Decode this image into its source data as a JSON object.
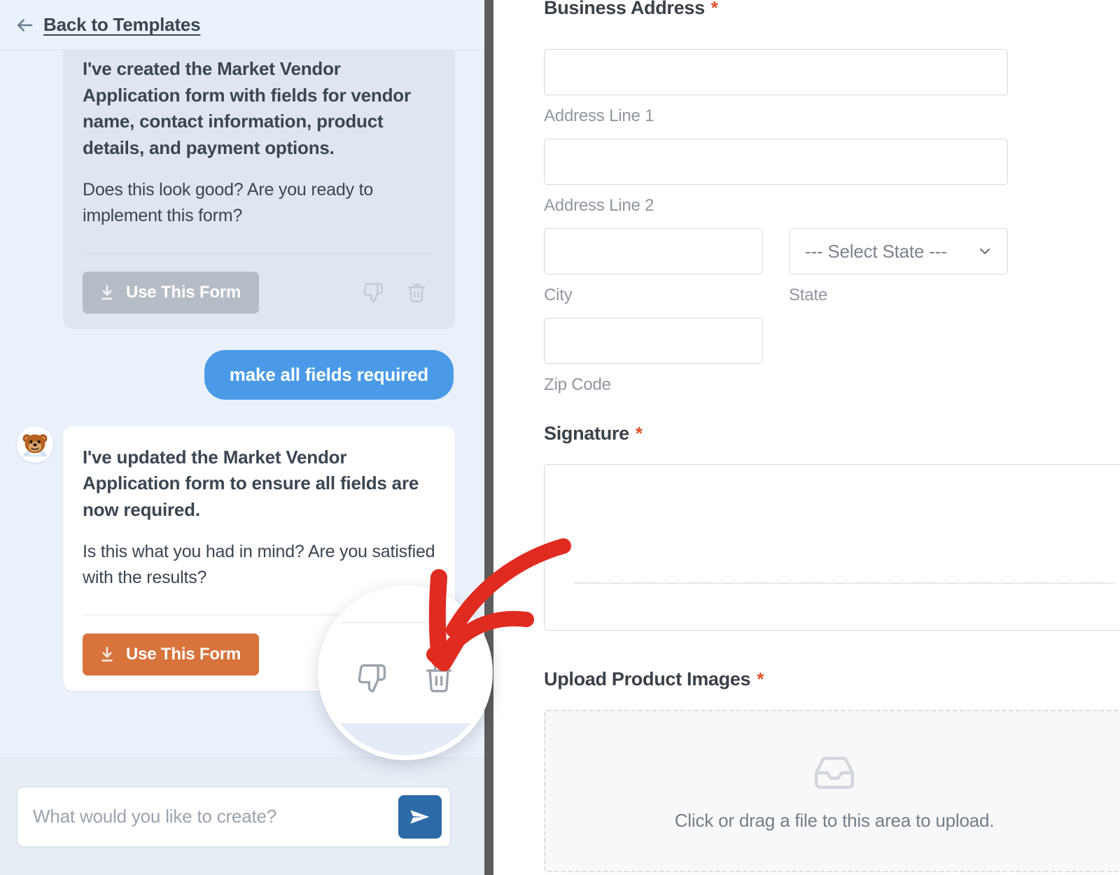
{
  "chat": {
    "header": {
      "back_label": "Back to Templates",
      "back_icon": "arrow-left-icon"
    },
    "messages": [
      {
        "role": "assistant",
        "state": "faded",
        "lead": "I've created the Market Vendor Application form with fields for vendor name, contact information, product details, and payment options.",
        "body": "Does this look good? Are you ready to implement this form?",
        "primary_button": "Use This Form",
        "actions": [
          "thumbs-down-icon",
          "trash-icon"
        ]
      },
      {
        "role": "user",
        "text": "make all fields required"
      },
      {
        "role": "assistant",
        "state": "active",
        "lead": "I've updated the Market Vendor Application form to ensure all fields are now required.",
        "body": "Is this what you had in mind? Are you satisfied with the results?",
        "primary_button": "Use This Form",
        "actions": [
          "thumbs-down-icon",
          "trash-icon"
        ]
      }
    ],
    "composer": {
      "placeholder": "What would you like to create?",
      "value": "",
      "send_icon": "send-icon"
    }
  },
  "form": {
    "fields": [
      {
        "label": "Business Address",
        "required_marker": "*",
        "inputs": [
          {
            "sub_label": "Address Line 1",
            "value": ""
          },
          {
            "sub_label": "Address Line 2",
            "value": ""
          },
          {
            "sub_label": "City",
            "value": ""
          },
          {
            "sub_label": "State",
            "value": "--- Select State ---",
            "type": "select"
          },
          {
            "sub_label": "Zip Code",
            "value": ""
          }
        ]
      },
      {
        "label": "Signature",
        "required_marker": "*"
      },
      {
        "label": "Upload Product Images",
        "required_marker": "*",
        "dropzone_text": "Click or drag a file to this area to upload.",
        "dropzone_icon": "inbox-icon"
      }
    ]
  },
  "annotation": {
    "callout_color": "#e02b20",
    "magnifier_target": "trash-icon",
    "magnifier_icons": [
      "thumbs-down-icon",
      "trash-icon"
    ]
  },
  "colors": {
    "user_bubble": "#4a9ae8",
    "primary_button": "#d8733c",
    "primary_button_disabled": "#b5bcc5",
    "send_button": "#2c6ba8",
    "required_asterisk": "#e2502a",
    "chat_background": "#eaf1fa",
    "divider": "#5c5c5c"
  }
}
